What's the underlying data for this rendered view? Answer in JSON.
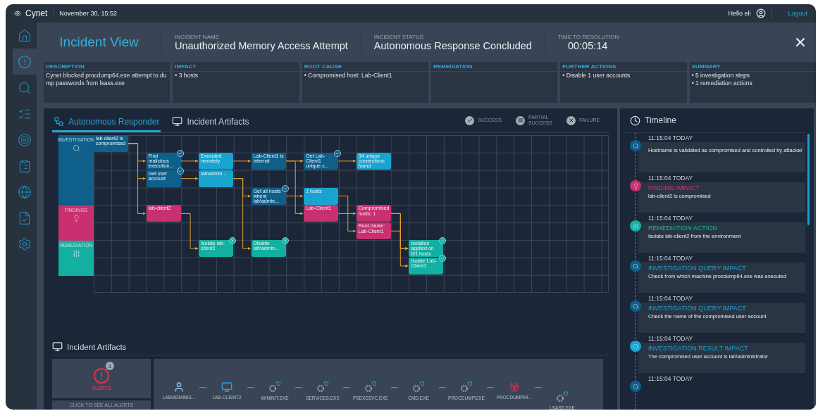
{
  "top_bar": {
    "logo": "Cynet",
    "date": "November 30, 15:52",
    "greeting": "Hello eli",
    "logout": "Logout"
  },
  "sidebar_items": [
    {
      "kind": "home",
      "selected": false
    },
    {
      "kind": "alert",
      "selected": true
    },
    {
      "kind": "search",
      "selected": false
    },
    {
      "kind": "checklist",
      "selected": false
    },
    {
      "kind": "target",
      "selected": false
    },
    {
      "kind": "report",
      "selected": false
    },
    {
      "kind": "globe",
      "selected": false
    },
    {
      "kind": "document",
      "selected": false
    },
    {
      "kind": "settings",
      "selected": false
    }
  ],
  "header": {
    "title": "Incident View",
    "fields": [
      {
        "label": "INCIDENT NAME",
        "value": "Unauthorized Memory Access Attempt"
      },
      {
        "label": "INCIDENT STATUS",
        "value": "Autonomous Response Concluded"
      },
      {
        "label": "TIME TO RESOLUTION",
        "value": "00:05:14"
      }
    ]
  },
  "cards": [
    {
      "title": "DESCRIPTION",
      "lines": [
        "Cynet blocked procdump64.exe attempt to dump passwords from lsass.exe"
      ]
    },
    {
      "title": "IMPACT",
      "lines": [
        "• 3 hosts"
      ]
    },
    {
      "title": "ROOT CAUSE",
      "lines": [
        "• Compromised host: Lab-Client1"
      ]
    },
    {
      "title": "REMEDIATION"
    },
    {
      "title": "FURTHER ACTIONS",
      "lines": [
        "• Disable 1 user accounts"
      ]
    },
    {
      "title": "SUMMARY",
      "lines": [
        "• 5 investigation steps",
        "• 1 remediation actions"
      ]
    }
  ],
  "tabs": [
    {
      "label": "Autonomous Responder",
      "kind": "flow",
      "selected": true
    },
    {
      "label": "Incident Artifacts",
      "kind": "artifacts",
      "selected": false
    }
  ],
  "legend": [
    {
      "kind": "success",
      "label": "SUCCESS"
    },
    {
      "kind": "partial",
      "label": "PARTIAL SUCCESS"
    },
    {
      "kind": "failure",
      "label": "FAILURE"
    }
  ],
  "lanes": [
    {
      "kind": "investigation",
      "label": "INVESTIGATION"
    },
    {
      "kind": "finding",
      "label": "FINDINGS"
    },
    {
      "kind": "remediation",
      "label": "REMEDIATION"
    }
  ],
  "nodes": [
    {
      "text": "lab-client2 is compromised",
      "kind": "query",
      "succeeded": false,
      "failed": false
    },
    {
      "text": "Find malicious execution...",
      "kind": "query",
      "succeeded": true,
      "failed": false
    },
    {
      "text": "Get user account",
      "kind": "query",
      "succeeded": true,
      "failed": false
    },
    {
      "text": "Executed remotely",
      "kind": "result",
      "succeeded": false,
      "failed": false
    },
    {
      "text": "lab\\admin...",
      "kind": "result",
      "succeeded": false,
      "failed": false
    },
    {
      "text": "Lab-Client1 is internal",
      "kind": "query",
      "succeeded": false,
      "failed": false
    },
    {
      "text": "Get Lab-Client1 unique c...",
      "kind": "query",
      "succeeded": true,
      "failed": false
    },
    {
      "text": "34 unique connections found",
      "kind": "result",
      "succeeded": false,
      "failed": false
    },
    {
      "text": "Get all hosts where lab\\admin...",
      "kind": "query",
      "succeeded": true,
      "failed": false
    },
    {
      "text": "1 hosts",
      "kind": "result",
      "succeeded": false,
      "failed": false
    },
    {
      "text": "lab-client2",
      "kind": "finding",
      "succeeded": false,
      "failed": false
    },
    {
      "text": "Lab-Client1",
      "kind": "finding",
      "succeeded": false,
      "failed": false
    },
    {
      "text": "Compromised hosts: 1",
      "kind": "finding",
      "succeeded": false,
      "failed": false
    },
    {
      "text": "Root cause: Lab-Client1",
      "kind": "finding",
      "succeeded": false,
      "failed": false
    },
    {
      "text": "Isolate lab-client2",
      "kind": "remediation",
      "succeeded": false,
      "failed": true
    },
    {
      "text": "Disable lab\\admin...",
      "kind": "remediation",
      "succeeded": false,
      "failed": true
    },
    {
      "text": "Isolation applied on 0/1 hosts",
      "kind": "remediation",
      "succeeded": true,
      "failed": false
    },
    {
      "text": "Isolate Lab-Client1",
      "kind": "remediation",
      "succeeded": true,
      "failed": false
    }
  ],
  "artifacts": {
    "title": "Incident Artifacts",
    "alerts": {
      "badge": "1",
      "label": "ALERTS",
      "link": "CLICK TO SEE ALL ALERTS"
    },
    "chain": [
      {
        "kind": "user",
        "label": "LAB\\ADMINIS..."
      },
      {
        "kind": "computer",
        "label": "LAB-CLIENT2"
      },
      {
        "kind": "process",
        "label": "WININIT.EXE"
      },
      {
        "kind": "process",
        "label": "SERVICES.EXE"
      },
      {
        "kind": "process",
        "label": "PSEXESVC.EXE"
      },
      {
        "kind": "process",
        "label": "CMD.EXE"
      },
      {
        "kind": "process",
        "label": "PROCDUMP.EXE"
      },
      {
        "kind": "threat",
        "label": "PROCDUMP64..."
      },
      {
        "kind": "process",
        "label": "LSASS.EXE"
      }
    ]
  },
  "timeline": {
    "title": "Timeline",
    "entries": [
      {
        "kind": "query",
        "time": "11:15:04 TODAY",
        "text": "Hostname is validated as compromised and controlled by attacker"
      },
      {
        "kind": "finding",
        "time": "11:15:04 TODAY",
        "title": "FINDING IMPACT",
        "text": "lab-client2 is compromised"
      },
      {
        "kind": "remediation",
        "time": "11:15:04 TODAY",
        "title": "REMEDIATION ACTION",
        "text": "Isolate lab-client2 from the environment"
      },
      {
        "kind": "query",
        "time": "11:15:04 TODAY",
        "title": "INVESTIGATION QUERY IMPACT",
        "text": "Check from which machine procdump64.exe was executed"
      },
      {
        "kind": "query",
        "time": "11:15:04 TODAY",
        "title": "INVESTIGATION QUERY IMPACT",
        "text": "Check the name of the compromised user account"
      },
      {
        "kind": "result",
        "time": "11:15:04 TODAY",
        "title": "INVESTIGATION RESULT IMPACT",
        "text": "The compromised user account is lab\\administrator"
      },
      {
        "kind": "query",
        "time": "11:15:04 TODAY"
      }
    ]
  }
}
